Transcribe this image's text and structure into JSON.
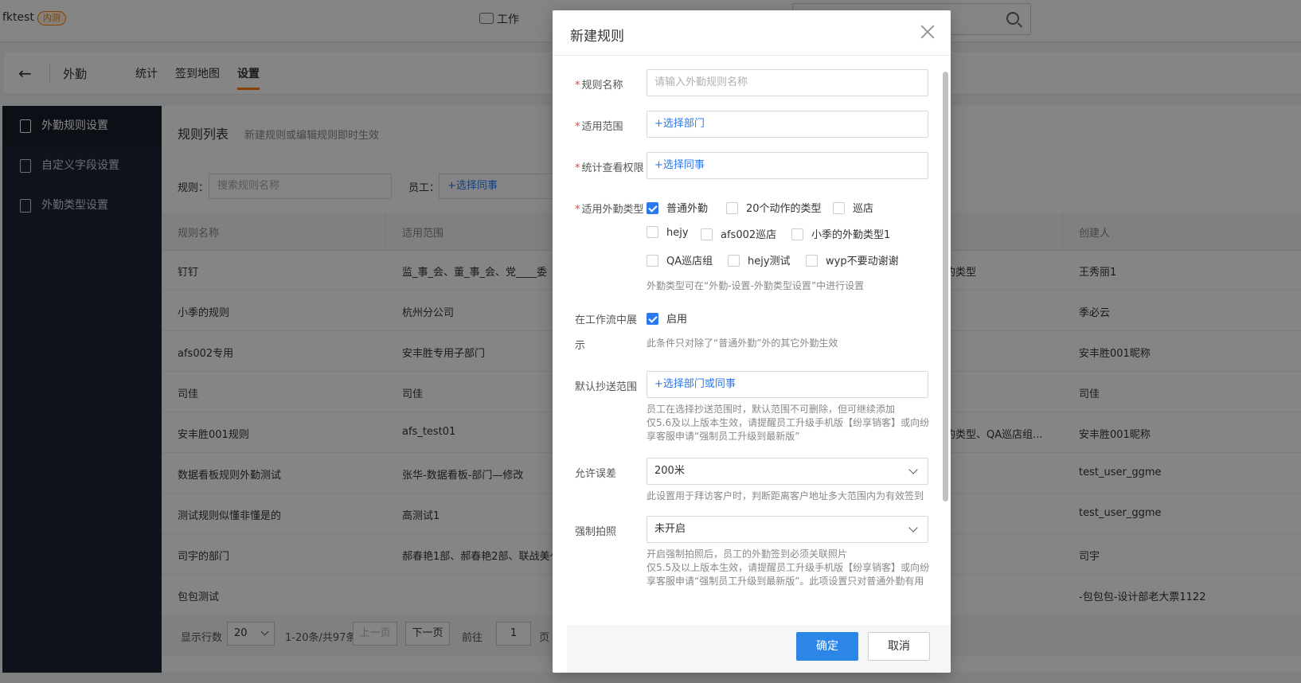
{
  "topbar": {
    "brand": "fktest",
    "badge": "内测",
    "work_label": "工作"
  },
  "navbar": {
    "back_glyph": "←",
    "title": "外勤",
    "tabs": [
      {
        "label": "统计"
      },
      {
        "label": "签到地图"
      },
      {
        "label": "设置"
      }
    ]
  },
  "sidebar": {
    "items": [
      {
        "label": "外勤规则设置"
      },
      {
        "label": "自定义字段设置"
      },
      {
        "label": "外勤类型设置"
      }
    ]
  },
  "main": {
    "title": "规则列表",
    "subtitle": "新建规则或编辑规则即时生效",
    "filter_rule_label": "规则：",
    "filter_rule_placeholder": "搜索规则名称",
    "filter_staff_label": "员工：",
    "filter_staff_value": "+选择同事",
    "columns": [
      "规则名称",
      "适用范围",
      "创建人"
    ],
    "rows": [
      {
        "name": "钉钉",
        "scope": "监_事_会、董_事_会、党____委",
        "type": "的类型",
        "creator": "王秀丽1"
      },
      {
        "name": "小季的规则",
        "scope": "杭州分公司",
        "type": "",
        "creator": "季必云"
      },
      {
        "name": "afs002专用",
        "scope": "安丰胜专用子部门",
        "type": "",
        "creator": "安丰胜001昵称"
      },
      {
        "name": "司佳",
        "scope": "司佳",
        "type": "",
        "creator": "司佳"
      },
      {
        "name": "安丰胜001规则",
        "scope": "afs_test01",
        "type": "的类型、QA巡店组...",
        "creator": "安丰胜001昵称"
      },
      {
        "name": "数据看板规则外勤测试",
        "scope": "张华-数据看板-部门—修改",
        "type": "",
        "creator": "test_user_ggme"
      },
      {
        "name": "测试规则似懂非懂是的",
        "scope": "高测试1",
        "type": "",
        "creator": "test_user_ggme"
      },
      {
        "name": "司宇的部门",
        "scope": "郝春艳1部、郝春艳2部、联战美亻",
        "type": "",
        "creator": "司宇"
      },
      {
        "name": "包包测试",
        "scope": "",
        "type": "",
        "creator": "-包包包-设计部老大票1122"
      }
    ],
    "pager": {
      "rows_label": "显示行数",
      "rows_value": "20",
      "range": "1-20条/共97条",
      "prev": "上一页",
      "next": "下一页",
      "goto": "前往",
      "page": "1",
      "page_unit": "页"
    }
  },
  "modal": {
    "title": "新建规则",
    "name_label": "规则名称",
    "name_placeholder": "请输入外勤规则名称",
    "scope_label": "适用范围",
    "scope_value": "+选择部门",
    "perm_label": "统计查看权限",
    "perm_value": "+选择同事",
    "types_label": "适用外勤类型",
    "types": [
      {
        "label": "普通外勤",
        "checked": true
      },
      {
        "label": "20个动作的类型",
        "checked": false
      },
      {
        "label": "巡店",
        "checked": false
      },
      {
        "label": "hejy",
        "checked": false
      },
      {
        "label": "afs002巡店",
        "checked": false
      },
      {
        "label": "小季的外勤类型1",
        "checked": false
      },
      {
        "label": "QA巡店组",
        "checked": false
      },
      {
        "label": "hejy测试",
        "checked": false
      },
      {
        "label": "wyp不要动谢谢",
        "checked": false
      }
    ],
    "types_hint": "外勤类型可在“外勤-设置-外勤类型设置”中进行设置",
    "workflow_label_1": "在工作流中展",
    "workflow_label_2": "示",
    "workflow_option": "启用",
    "workflow_hint": "此条件只对除了“普通外勤”外的其它外勤生效",
    "cc_label": "默认抄送范围",
    "cc_value": "+选择部门或同事",
    "cc_hint_1": "员工在选择抄送范围时，默认范围不可删除，但可继续添加",
    "cc_hint_2": "仅5.6及以上版本生效，请提醒员工升级手机版【纷享销客】或向纷享客服申请“强制员工升级到最新版”",
    "tolerance_label": "允许误差",
    "tolerance_value": "200米",
    "tolerance_hint": "此设置用于拜访客户时，判断距离客户地址多大范围内为有效签到",
    "photo_label": "强制拍照",
    "photo_value": "未开启",
    "photo_hint_1": "开启强制拍照后，员工的外勤签到必须关联照片",
    "photo_hint_2": "仅5.5及以上版本生效，请提醒员工升级手机版【纷享销客】或向纷享客服申请“强制员工升级到最新版”。此项设置只对普通外勤有用",
    "confirm": "确定",
    "cancel": "取消"
  }
}
